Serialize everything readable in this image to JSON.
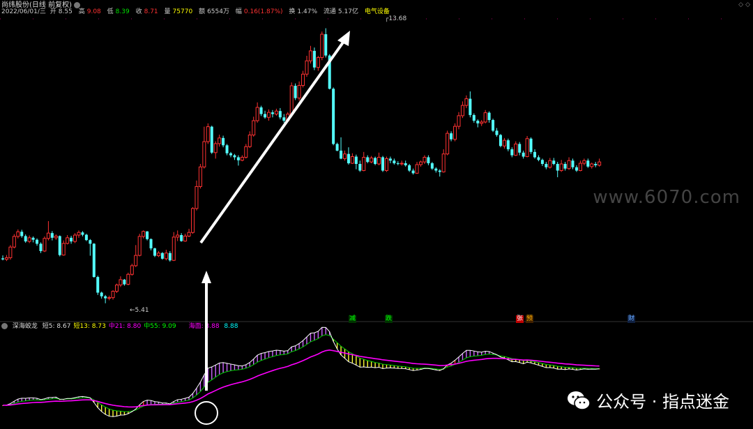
{
  "header": {
    "stock_name": "尚纬股份(日线 前复权)",
    "date": "2022/06/01/三",
    "open_label": "开",
    "open_value": "8.55",
    "high_label": "高",
    "high_value": "9.08",
    "low_label": "低",
    "low_value": "8.39",
    "close_label": "收",
    "close_value": "8.71",
    "volume_label": "量",
    "volume_value": "75770",
    "amount_label": "额",
    "amount_value": "6554万",
    "change_label": "幅",
    "change_value": "0.16(1.87%)",
    "turnover_label": "换",
    "turnover_value": "1.47%",
    "float_label": "流通",
    "float_value": "5.17亿",
    "sector": "电气设备"
  },
  "price_chart": {
    "high_marker": "13.68",
    "low_marker": "5.41",
    "watermark": "www.6070.com"
  },
  "indicator": {
    "name": "深海蛟龙",
    "items": [
      {
        "label": "短5:",
        "value": "8.67",
        "color": "#dddddd"
      },
      {
        "label": "短13:",
        "value": "8.73",
        "color": "#ffff00"
      },
      {
        "label": "中21:",
        "value": "8.80",
        "color": "#ff00ff"
      },
      {
        "label": "中55:",
        "value": "9.09",
        "color": "#00ff00"
      },
      {
        "label": "海面:",
        "value": "8.88",
        "color": "#ff00ff"
      },
      {
        "label": "",
        "value": "8.88",
        "color": "#00ffff"
      }
    ]
  },
  "markers": {
    "m1": "减",
    "m2": "跌",
    "m3": "张",
    "m4": "预",
    "m5": "财"
  },
  "wechat": {
    "text": "公众号 · 指点迷金"
  },
  "colors": {
    "up": "#ff3232",
    "down": "#54ffff",
    "background": "#000000"
  },
  "chart_data": {
    "type": "candlestick",
    "title": "尚纬股份(日线 前复权)",
    "candles": [
      [
        6.76,
        6.73,
        6.85,
        6.7
      ],
      [
        6.73,
        6.78,
        6.86,
        6.68
      ],
      [
        6.78,
        7.1,
        7.16,
        6.72
      ],
      [
        7.1,
        7.42,
        7.49,
        7.06
      ],
      [
        7.42,
        7.56,
        7.63,
        7.36
      ],
      [
        7.56,
        7.43,
        7.62,
        7.38
      ],
      [
        7.43,
        7.27,
        7.48,
        7.23
      ],
      [
        7.27,
        7.38,
        7.45,
        7.22
      ],
      [
        7.38,
        7.32,
        7.42,
        7.24
      ],
      [
        7.32,
        7.2,
        7.36,
        7.14
      ],
      [
        7.2,
        6.98,
        7.24,
        6.92
      ],
      [
        6.98,
        7.36,
        7.42,
        6.95
      ],
      [
        7.36,
        7.52,
        7.88,
        7.3
      ],
      [
        7.52,
        7.38,
        7.58,
        7.3
      ],
      [
        7.38,
        7.43,
        7.48,
        7.32
      ],
      [
        7.43,
        6.86,
        7.45,
        6.82
      ],
      [
        6.86,
        7.21,
        7.3,
        6.84
      ],
      [
        7.21,
        7.38,
        7.46,
        7.18
      ],
      [
        7.38,
        7.27,
        7.44,
        7.2
      ],
      [
        7.27,
        7.46,
        7.52,
        7.22
      ],
      [
        7.46,
        7.54,
        7.6,
        7.38
      ],
      [
        7.54,
        7.47,
        7.58,
        7.42
      ],
      [
        7.47,
        7.31,
        7.5,
        7.28
      ],
      [
        7.31,
        7.2,
        7.34,
        6.84
      ],
      [
        7.2,
        6.2,
        7.22,
        6.18
      ],
      [
        6.2,
        5.73,
        6.24,
        5.66
      ],
      [
        5.73,
        5.62,
        5.76,
        5.55
      ],
      [
        5.62,
        5.56,
        5.66,
        5.41
      ],
      [
        5.56,
        5.58,
        5.64,
        5.5
      ],
      [
        5.58,
        5.77,
        5.8,
        5.52
      ],
      [
        5.77,
        5.96,
        6.0,
        5.72
      ],
      [
        5.96,
        6.12,
        6.22,
        5.9
      ],
      [
        6.12,
        5.98,
        6.14,
        5.94
      ],
      [
        5.98,
        6.28,
        6.33,
        5.95
      ],
      [
        6.28,
        6.54,
        6.6,
        6.24
      ],
      [
        6.54,
        6.85,
        7.16,
        6.5
      ],
      [
        6.85,
        7.42,
        7.5,
        6.82
      ],
      [
        7.42,
        7.57,
        7.6,
        7.36
      ],
      [
        7.57,
        7.34,
        7.58,
        7.3
      ],
      [
        7.34,
        7.06,
        7.36,
        7.0
      ],
      [
        7.06,
        6.84,
        7.08,
        6.8
      ],
      [
        6.84,
        6.92,
        6.98,
        6.8
      ],
      [
        6.92,
        6.75,
        6.95,
        6.72
      ],
      [
        6.75,
        6.92,
        7.02,
        6.7
      ],
      [
        6.92,
        6.7,
        6.98,
        6.66
      ],
      [
        6.7,
        7.4,
        7.55,
        6.68
      ],
      [
        7.4,
        7.46,
        7.6,
        7.28
      ],
      [
        7.46,
        7.28,
        7.52,
        7.26
      ],
      [
        7.28,
        7.43,
        7.5,
        7.26
      ],
      [
        7.43,
        7.54,
        7.65,
        7.4
      ],
      [
        7.54,
        8.26,
        8.3,
        7.5
      ],
      [
        8.26,
        8.92,
        9.1,
        8.2
      ],
      [
        8.92,
        9.51,
        9.6,
        8.86
      ],
      [
        9.51,
        10.27,
        10.72,
        9.46
      ],
      [
        10.27,
        10.72,
        10.82,
        10.2
      ],
      [
        10.72,
        9.94,
        10.75,
        9.9
      ],
      [
        9.94,
        10.21,
        10.28,
        9.76
      ],
      [
        10.21,
        10.38,
        10.48,
        10.12
      ],
      [
        10.38,
        10.16,
        10.45,
        10.1
      ],
      [
        10.16,
        9.92,
        10.2,
        9.86
      ],
      [
        9.92,
        9.86,
        9.96,
        9.8
      ],
      [
        9.86,
        9.8,
        9.9,
        9.72
      ],
      [
        9.8,
        9.71,
        9.86,
        9.55
      ],
      [
        9.71,
        9.8,
        9.86,
        9.68
      ],
      [
        9.8,
        10.12,
        10.2,
        9.76
      ],
      [
        10.12,
        10.47,
        10.58,
        10.08
      ],
      [
        10.47,
        10.9,
        11.02,
        10.42
      ],
      [
        10.9,
        11.3,
        11.45,
        10.84
      ],
      [
        11.3,
        11.1,
        11.35,
        11.04
      ],
      [
        11.1,
        11.0,
        11.2,
        10.96
      ],
      [
        11.0,
        11.15,
        11.24,
        10.9
      ],
      [
        11.15,
        11.1,
        11.22,
        11.0
      ],
      [
        11.1,
        11.19,
        11.26,
        11.05
      ],
      [
        11.19,
        11.0,
        11.28,
        10.94
      ],
      [
        11.0,
        10.9,
        11.1,
        10.84
      ],
      [
        10.9,
        11.1,
        11.16,
        10.86
      ],
      [
        11.1,
        11.95,
        12.05,
        11.05
      ],
      [
        11.95,
        11.58,
        12.02,
        11.52
      ],
      [
        11.58,
        11.96,
        12.08,
        11.5
      ],
      [
        11.96,
        12.3,
        12.4,
        11.9
      ],
      [
        12.3,
        12.7,
        12.85,
        12.22
      ],
      [
        12.7,
        13.0,
        13.15,
        12.62
      ],
      [
        13.0,
        12.5,
        13.1,
        12.42
      ],
      [
        12.5,
        12.8,
        12.85,
        12.4
      ],
      [
        12.8,
        13.5,
        13.58,
        12.72
      ],
      [
        13.5,
        12.86,
        13.68,
        12.8
      ],
      [
        12.86,
        11.86,
        12.9,
        11.84
      ],
      [
        11.86,
        10.2,
        11.9,
        10.16
      ],
      [
        10.2,
        10.0,
        10.24,
        9.98
      ],
      [
        10.0,
        9.76,
        10.4,
        9.74
      ],
      [
        9.76,
        9.9,
        10.0,
        9.7
      ],
      [
        9.9,
        9.62,
        10.1,
        9.58
      ],
      [
        9.62,
        9.82,
        9.92,
        9.6
      ],
      [
        9.82,
        9.6,
        9.88,
        9.44
      ],
      [
        9.6,
        9.4,
        9.7,
        9.36
      ],
      [
        9.4,
        9.8,
        9.96,
        9.38
      ],
      [
        9.8,
        9.66,
        9.86,
        9.62
      ],
      [
        9.66,
        9.78,
        9.84,
        9.62
      ],
      [
        9.78,
        9.6,
        9.82,
        9.56
      ],
      [
        9.6,
        9.8,
        9.94,
        9.56
      ],
      [
        9.8,
        9.4,
        9.84,
        9.36
      ],
      [
        9.4,
        9.76,
        9.82,
        9.36
      ],
      [
        9.76,
        9.7,
        9.82,
        9.62
      ],
      [
        9.7,
        9.62,
        9.76,
        9.58
      ],
      [
        9.62,
        9.6,
        9.68,
        9.56
      ],
      [
        9.6,
        9.62,
        9.7,
        9.55
      ],
      [
        9.62,
        9.56,
        9.7,
        9.52
      ],
      [
        9.56,
        9.4,
        9.6,
        9.36
      ],
      [
        9.4,
        9.32,
        9.46,
        9.28
      ],
      [
        9.32,
        9.58,
        9.66,
        9.3
      ],
      [
        9.58,
        9.66,
        9.7,
        9.52
      ],
      [
        9.66,
        9.8,
        9.86,
        9.6
      ],
      [
        9.8,
        9.62,
        9.86,
        9.56
      ],
      [
        9.62,
        9.46,
        9.66,
        9.42
      ],
      [
        9.46,
        9.4,
        9.5,
        9.34
      ],
      [
        9.4,
        9.36,
        9.44,
        9.22
      ],
      [
        9.36,
        9.9,
        10.04,
        9.34
      ],
      [
        9.9,
        10.52,
        10.6,
        9.86
      ],
      [
        10.52,
        10.34,
        10.58,
        10.28
      ],
      [
        10.34,
        10.73,
        10.82,
        10.28
      ],
      [
        10.73,
        11.05,
        11.16,
        10.64
      ],
      [
        11.05,
        11.36,
        11.48,
        10.98
      ],
      [
        11.36,
        11.56,
        11.66,
        11.28
      ],
      [
        11.56,
        11.07,
        11.78,
        11.0
      ],
      [
        11.07,
        10.9,
        11.12,
        10.84
      ],
      [
        10.9,
        10.82,
        10.94,
        10.7
      ],
      [
        10.82,
        10.86,
        10.92,
        10.74
      ],
      [
        10.86,
        11.14,
        11.22,
        10.82
      ],
      [
        11.14,
        10.92,
        11.18,
        10.84
      ],
      [
        10.92,
        10.6,
        10.96,
        10.56
      ],
      [
        10.6,
        10.47,
        10.68,
        10.42
      ],
      [
        10.47,
        10.14,
        10.5,
        10.1
      ],
      [
        10.14,
        10.31,
        10.38,
        10.06
      ],
      [
        10.31,
        10.04,
        10.36,
        9.98
      ],
      [
        10.04,
        9.86,
        10.1,
        9.8
      ],
      [
        9.86,
        10.2,
        10.28,
        9.84
      ],
      [
        10.2,
        9.94,
        10.26,
        9.86
      ],
      [
        9.94,
        9.82,
        10.0,
        9.76
      ],
      [
        9.82,
        10.36,
        10.44,
        9.8
      ],
      [
        10.36,
        9.96,
        10.4,
        9.9
      ],
      [
        9.96,
        9.8,
        10.04,
        9.76
      ],
      [
        9.8,
        9.72,
        9.86,
        9.68
      ],
      [
        9.72,
        9.6,
        9.76,
        9.54
      ],
      [
        9.6,
        9.5,
        9.66,
        9.44
      ],
      [
        9.5,
        9.7,
        9.78,
        9.46
      ],
      [
        9.7,
        9.6,
        9.78,
        9.56
      ],
      [
        9.6,
        9.4,
        9.66,
        9.2
      ],
      [
        9.4,
        9.6,
        9.72,
        9.36
      ],
      [
        9.6,
        9.46,
        9.66,
        9.4
      ],
      [
        9.46,
        9.7,
        9.8,
        9.42
      ],
      [
        9.7,
        9.5,
        9.76,
        9.44
      ],
      [
        9.5,
        9.4,
        9.56,
        9.36
      ],
      [
        9.4,
        9.62,
        9.7,
        9.38
      ],
      [
        9.62,
        9.7,
        9.76,
        9.56
      ],
      [
        9.7,
        9.52,
        9.76,
        9.48
      ],
      [
        9.52,
        9.6,
        9.64,
        9.46
      ],
      [
        9.6,
        9.56,
        9.66,
        9.5
      ],
      [
        9.56,
        9.66,
        9.76,
        9.52
      ]
    ]
  }
}
